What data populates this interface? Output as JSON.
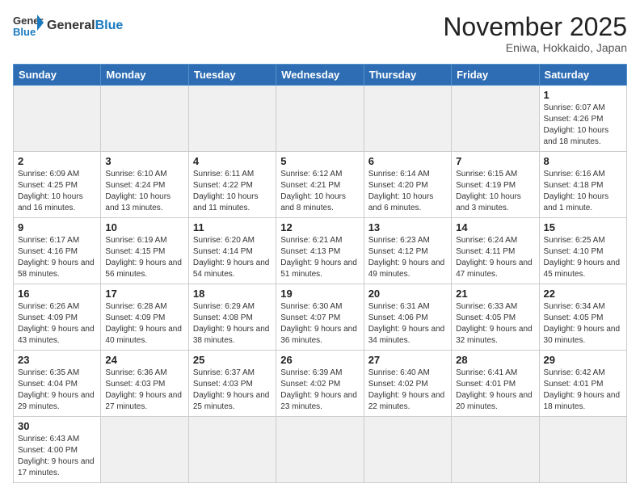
{
  "header": {
    "logo_general": "General",
    "logo_blue": "Blue",
    "month_title": "November 2025",
    "location": "Eniwa, Hokkaido, Japan"
  },
  "days_of_week": [
    "Sunday",
    "Monday",
    "Tuesday",
    "Wednesday",
    "Thursday",
    "Friday",
    "Saturday"
  ],
  "weeks": [
    [
      {
        "day": null,
        "info": null
      },
      {
        "day": null,
        "info": null
      },
      {
        "day": null,
        "info": null
      },
      {
        "day": null,
        "info": null
      },
      {
        "day": null,
        "info": null
      },
      {
        "day": null,
        "info": null
      },
      {
        "day": "1",
        "info": "Sunrise: 6:07 AM\nSunset: 4:26 PM\nDaylight: 10 hours\nand 18 minutes."
      }
    ],
    [
      {
        "day": "2",
        "info": "Sunrise: 6:09 AM\nSunset: 4:25 PM\nDaylight: 10 hours\nand 16 minutes."
      },
      {
        "day": "3",
        "info": "Sunrise: 6:10 AM\nSunset: 4:24 PM\nDaylight: 10 hours\nand 13 minutes."
      },
      {
        "day": "4",
        "info": "Sunrise: 6:11 AM\nSunset: 4:22 PM\nDaylight: 10 hours\nand 11 minutes."
      },
      {
        "day": "5",
        "info": "Sunrise: 6:12 AM\nSunset: 4:21 PM\nDaylight: 10 hours\nand 8 minutes."
      },
      {
        "day": "6",
        "info": "Sunrise: 6:14 AM\nSunset: 4:20 PM\nDaylight: 10 hours\nand 6 minutes."
      },
      {
        "day": "7",
        "info": "Sunrise: 6:15 AM\nSunset: 4:19 PM\nDaylight: 10 hours\nand 3 minutes."
      },
      {
        "day": "8",
        "info": "Sunrise: 6:16 AM\nSunset: 4:18 PM\nDaylight: 10 hours\nand 1 minute."
      }
    ],
    [
      {
        "day": "9",
        "info": "Sunrise: 6:17 AM\nSunset: 4:16 PM\nDaylight: 9 hours\nand 58 minutes."
      },
      {
        "day": "10",
        "info": "Sunrise: 6:19 AM\nSunset: 4:15 PM\nDaylight: 9 hours\nand 56 minutes."
      },
      {
        "day": "11",
        "info": "Sunrise: 6:20 AM\nSunset: 4:14 PM\nDaylight: 9 hours\nand 54 minutes."
      },
      {
        "day": "12",
        "info": "Sunrise: 6:21 AM\nSunset: 4:13 PM\nDaylight: 9 hours\nand 51 minutes."
      },
      {
        "day": "13",
        "info": "Sunrise: 6:23 AM\nSunset: 4:12 PM\nDaylight: 9 hours\nand 49 minutes."
      },
      {
        "day": "14",
        "info": "Sunrise: 6:24 AM\nSunset: 4:11 PM\nDaylight: 9 hours\nand 47 minutes."
      },
      {
        "day": "15",
        "info": "Sunrise: 6:25 AM\nSunset: 4:10 PM\nDaylight: 9 hours\nand 45 minutes."
      }
    ],
    [
      {
        "day": "16",
        "info": "Sunrise: 6:26 AM\nSunset: 4:09 PM\nDaylight: 9 hours\nand 43 minutes."
      },
      {
        "day": "17",
        "info": "Sunrise: 6:28 AM\nSunset: 4:09 PM\nDaylight: 9 hours\nand 40 minutes."
      },
      {
        "day": "18",
        "info": "Sunrise: 6:29 AM\nSunset: 4:08 PM\nDaylight: 9 hours\nand 38 minutes."
      },
      {
        "day": "19",
        "info": "Sunrise: 6:30 AM\nSunset: 4:07 PM\nDaylight: 9 hours\nand 36 minutes."
      },
      {
        "day": "20",
        "info": "Sunrise: 6:31 AM\nSunset: 4:06 PM\nDaylight: 9 hours\nand 34 minutes."
      },
      {
        "day": "21",
        "info": "Sunrise: 6:33 AM\nSunset: 4:05 PM\nDaylight: 9 hours\nand 32 minutes."
      },
      {
        "day": "22",
        "info": "Sunrise: 6:34 AM\nSunset: 4:05 PM\nDaylight: 9 hours\nand 30 minutes."
      }
    ],
    [
      {
        "day": "23",
        "info": "Sunrise: 6:35 AM\nSunset: 4:04 PM\nDaylight: 9 hours\nand 29 minutes."
      },
      {
        "day": "24",
        "info": "Sunrise: 6:36 AM\nSunset: 4:03 PM\nDaylight: 9 hours\nand 27 minutes."
      },
      {
        "day": "25",
        "info": "Sunrise: 6:37 AM\nSunset: 4:03 PM\nDaylight: 9 hours\nand 25 minutes."
      },
      {
        "day": "26",
        "info": "Sunrise: 6:39 AM\nSunset: 4:02 PM\nDaylight: 9 hours\nand 23 minutes."
      },
      {
        "day": "27",
        "info": "Sunrise: 6:40 AM\nSunset: 4:02 PM\nDaylight: 9 hours\nand 22 minutes."
      },
      {
        "day": "28",
        "info": "Sunrise: 6:41 AM\nSunset: 4:01 PM\nDaylight: 9 hours\nand 20 minutes."
      },
      {
        "day": "29",
        "info": "Sunrise: 6:42 AM\nSunset: 4:01 PM\nDaylight: 9 hours\nand 18 minutes."
      }
    ],
    [
      {
        "day": "30",
        "info": "Sunrise: 6:43 AM\nSunset: 4:00 PM\nDaylight: 9 hours\nand 17 minutes."
      },
      {
        "day": null,
        "info": null
      },
      {
        "day": null,
        "info": null
      },
      {
        "day": null,
        "info": null
      },
      {
        "day": null,
        "info": null
      },
      {
        "day": null,
        "info": null
      },
      {
        "day": null,
        "info": null
      }
    ]
  ]
}
